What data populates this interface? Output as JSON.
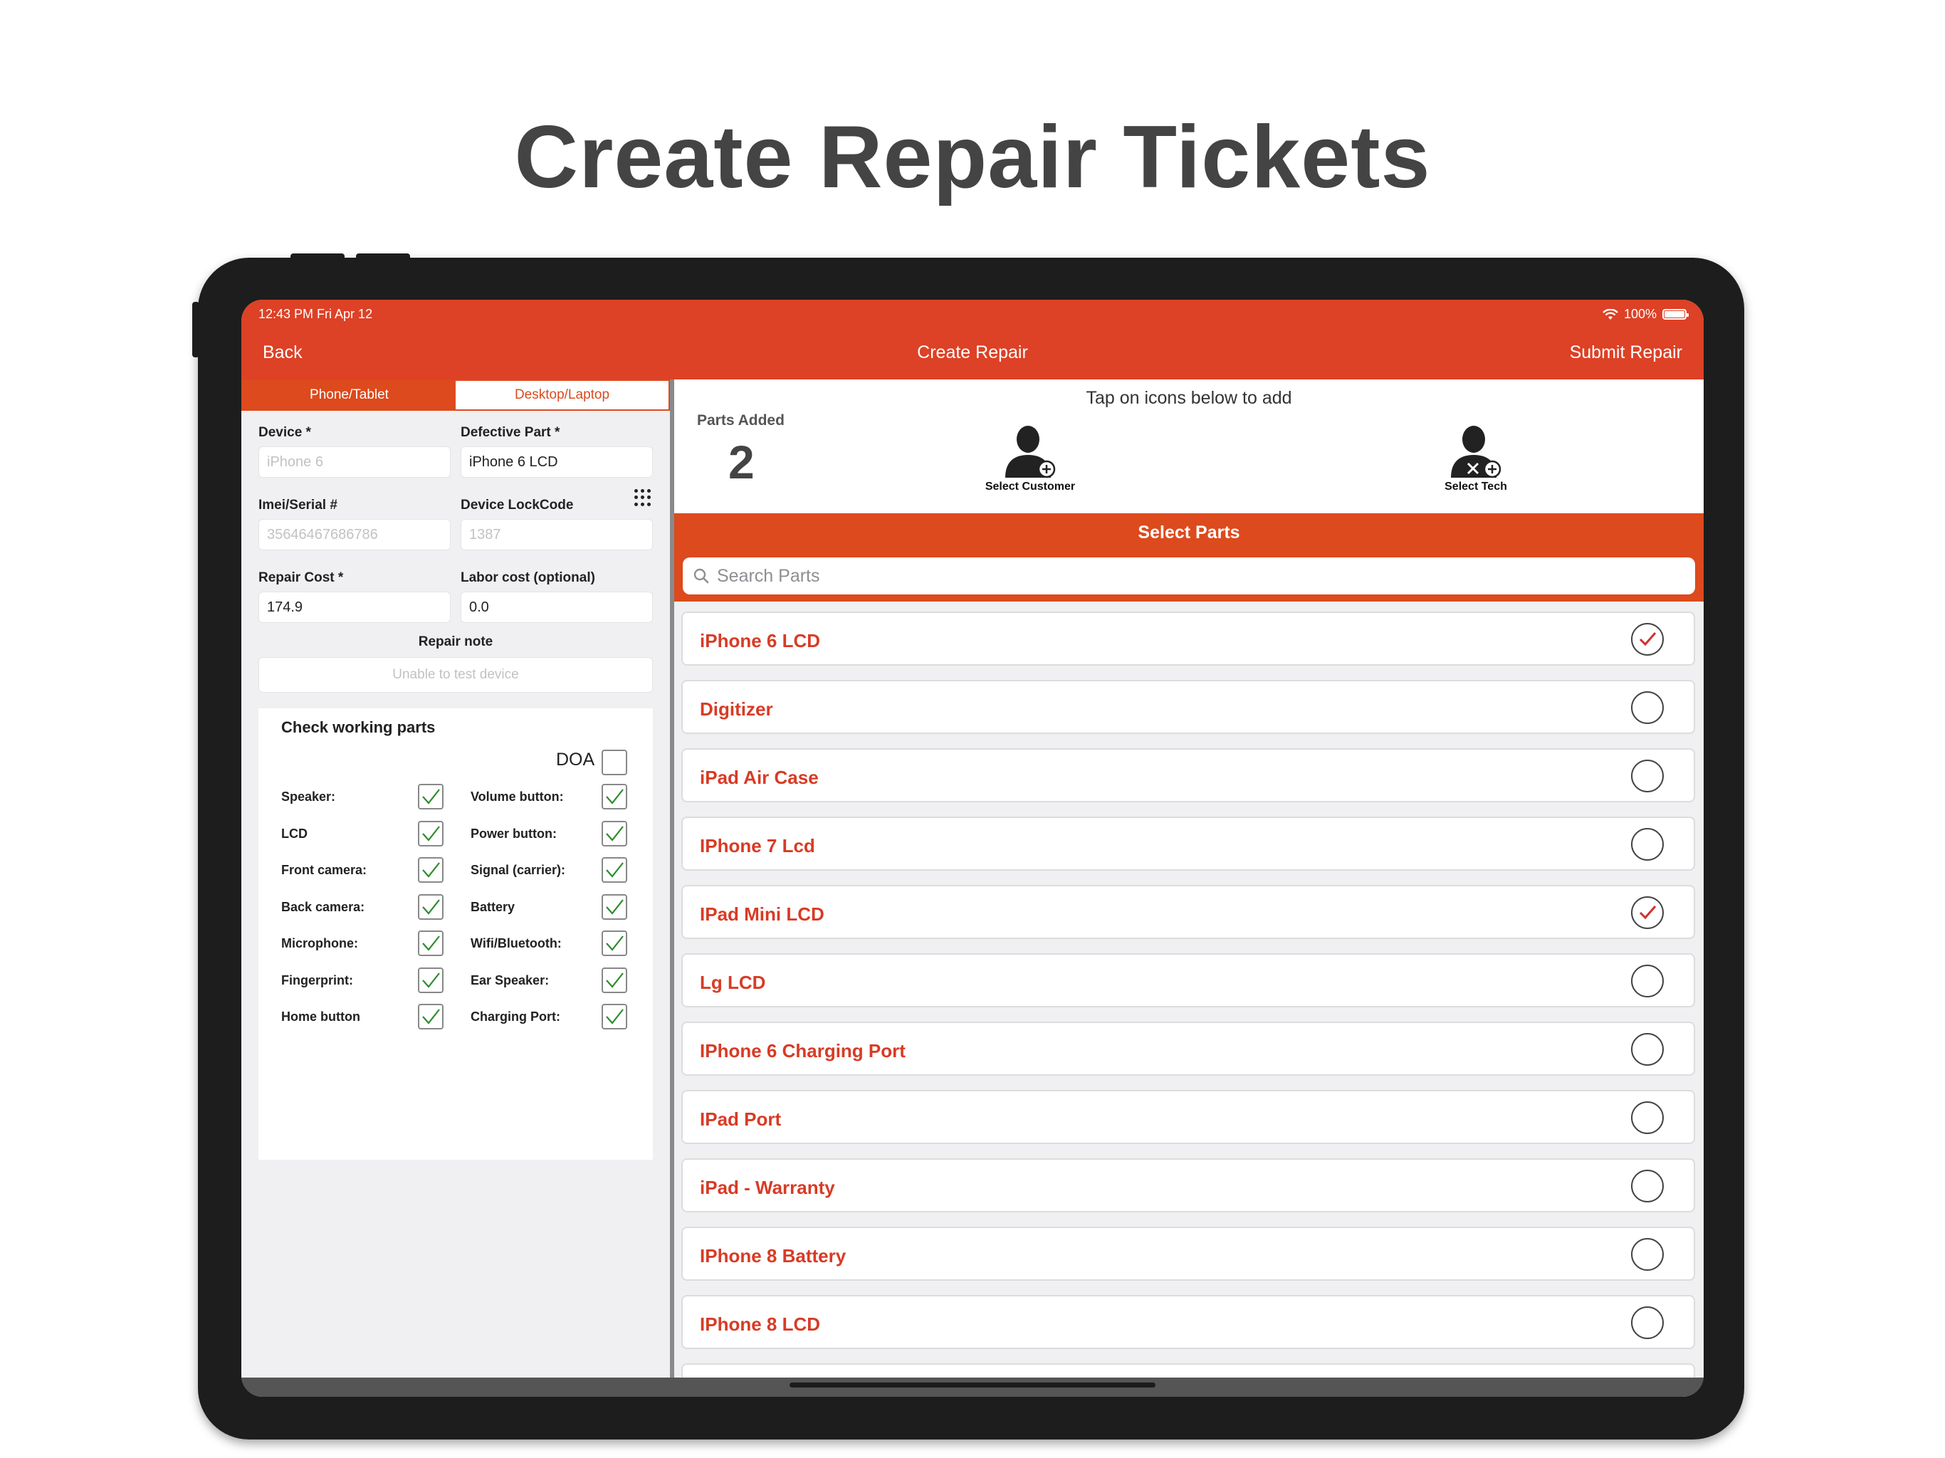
{
  "headline": "Create Repair Tickets",
  "status": {
    "time": "12:43 PM   Fri Apr 12",
    "battery": "100%"
  },
  "nav": {
    "back": "Back",
    "title": "Create Repair",
    "submit": "Submit Repair"
  },
  "segments": {
    "phone": "Phone/Tablet",
    "desktop": "Desktop/Laptop"
  },
  "form": {
    "device_label": "Device *",
    "device_placeholder": "iPhone 6",
    "defective_label": "Defective Part *",
    "defective_value": "iPhone 6 LCD",
    "imei_label": "Imei/Serial #",
    "imei_placeholder": "35646467686786",
    "lock_label": "Device LockCode",
    "lock_placeholder": "1387",
    "cost_label": "Repair Cost *",
    "cost_value": "174.9",
    "labor_label": "Labor cost (optional)",
    "labor_value": "0.0",
    "note_label": "Repair note",
    "note_placeholder": "Unable to test device"
  },
  "checks": {
    "title": "Check working parts",
    "doa": "DOA",
    "left": [
      "Speaker:",
      "LCD",
      "Front camera:",
      "Back camera:",
      "Microphone:",
      "Fingerprint:",
      "Home button"
    ],
    "right": [
      "Volume button:",
      "Power button:",
      "Signal (carrier):",
      "Battery",
      "Wifi/Bluetooth:",
      "Ear Speaker:",
      "Charging Port:"
    ]
  },
  "right": {
    "hint": "Tap on icons below to add",
    "parts_added_label": "Parts Added",
    "parts_added": "2",
    "select_customer": "Select Customer",
    "select_tech": "Select Tech",
    "select_parts": "Select Parts",
    "search_placeholder": "Search Parts"
  },
  "parts": [
    {
      "name": "iPhone 6 LCD",
      "selected": true
    },
    {
      "name": "Digitizer",
      "selected": false
    },
    {
      "name": "iPad Air Case",
      "selected": false
    },
    {
      "name": "IPhone 7 Lcd",
      "selected": false
    },
    {
      "name": "IPad Mini LCD",
      "selected": true
    },
    {
      "name": "Lg LCD",
      "selected": false
    },
    {
      "name": "IPhone 6 Charging Port",
      "selected": false
    },
    {
      "name": "IPad Port",
      "selected": false
    },
    {
      "name": "iPad - Warranty",
      "selected": false
    },
    {
      "name": "IPhone 8 Battery",
      "selected": false
    },
    {
      "name": "IPhone 8 LCD",
      "selected": false
    }
  ],
  "colors": {
    "accent": "#dd4126",
    "part_text": "#d83b25",
    "check_green": "#2e8b2e",
    "check_red": "#d32f2f"
  }
}
